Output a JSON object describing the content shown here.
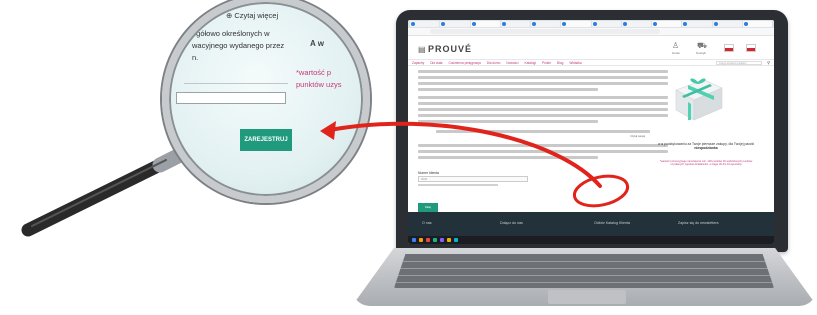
{
  "site": {
    "logo_text": "PROUVÉ",
    "header_icons": [
      {
        "icon": "user-icon",
        "label": "Konto"
      },
      {
        "icon": "cart-icon",
        "label": "Koszyk"
      }
    ],
    "nav": [
      "Zapachy",
      "Dla ciała",
      "Codzienna pielęgnacja",
      "Dla domu",
      "Nowości",
      "Katalogi",
      "Prokie",
      "Blog",
      "Wkładka"
    ],
    "search_placeholder": "Czego szukasz produktu",
    "content": {
      "read_more": "Czytaj więcej",
      "form_label": "Numer klienta",
      "form_value": "0000",
      "left_button": "Dalej",
      "register_button": "ZAREJESTRUJ"
    },
    "side": {
      "text_before": "a w podziękowaniu za Twoje pierwsze zakupy, dla Twojej paczki",
      "text_strong": "niespodzianka",
      "note": "*wartość promocyjnego zamówienia min. 130 punktów 20 wydzielonych punktów uzyskanych zgodnie działalności, w ciągu 30 dni od rejestracji"
    },
    "footer": [
      "O nas",
      "Dołącz do nas",
      "Odbiór Katalog Klienta",
      "Zapisz się do newslettera"
    ]
  },
  "magnifier": {
    "read_more": "Czytaj więcej",
    "line1": "egółowo określonych w",
    "line2": "wacyjnego wydanego przez",
    "line3": "n.",
    "aw": "A w",
    "note1": "*wartość p",
    "note2": "punktów uzys",
    "button": "ZAREJESTRUJ"
  },
  "colors": {
    "accent_green": "#1f9a7c",
    "accent_pink": "#c13a7a",
    "annotation_red": "#e0241b"
  }
}
